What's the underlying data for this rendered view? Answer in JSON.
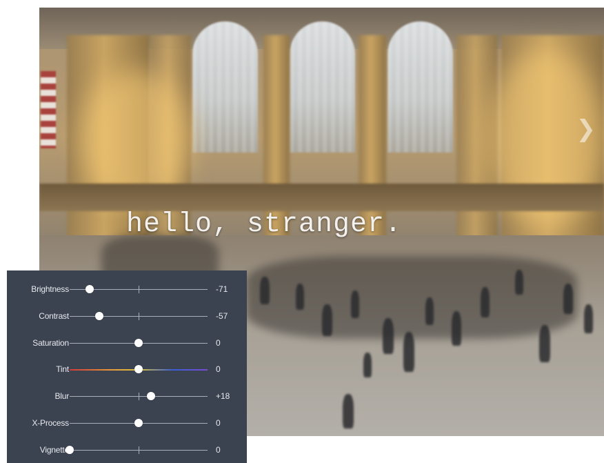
{
  "photo": {
    "tagline": "hello, stranger.",
    "next_icon": "chevron-right-icon"
  },
  "adjustments": [
    {
      "label": "Brightness",
      "value": "-71",
      "position": -0.71,
      "track": "plain"
    },
    {
      "label": "Contrast",
      "value": "-57",
      "position": -0.57,
      "track": "plain"
    },
    {
      "label": "Saturation",
      "value": "0",
      "position": 0,
      "track": "plain"
    },
    {
      "label": "Tint",
      "value": "0",
      "position": 0,
      "track": "tint"
    },
    {
      "label": "Blur",
      "value": "+18",
      "position": 0.18,
      "track": "plain"
    },
    {
      "label": "X-Process",
      "value": "0",
      "position": 0,
      "track": "plain"
    },
    {
      "label": "Vignette",
      "value": "0",
      "position": -1,
      "track": "plain"
    }
  ],
  "colors": {
    "panel_bg": "#3b4250",
    "text": "#e8eaee",
    "knob": "#ffffff"
  }
}
